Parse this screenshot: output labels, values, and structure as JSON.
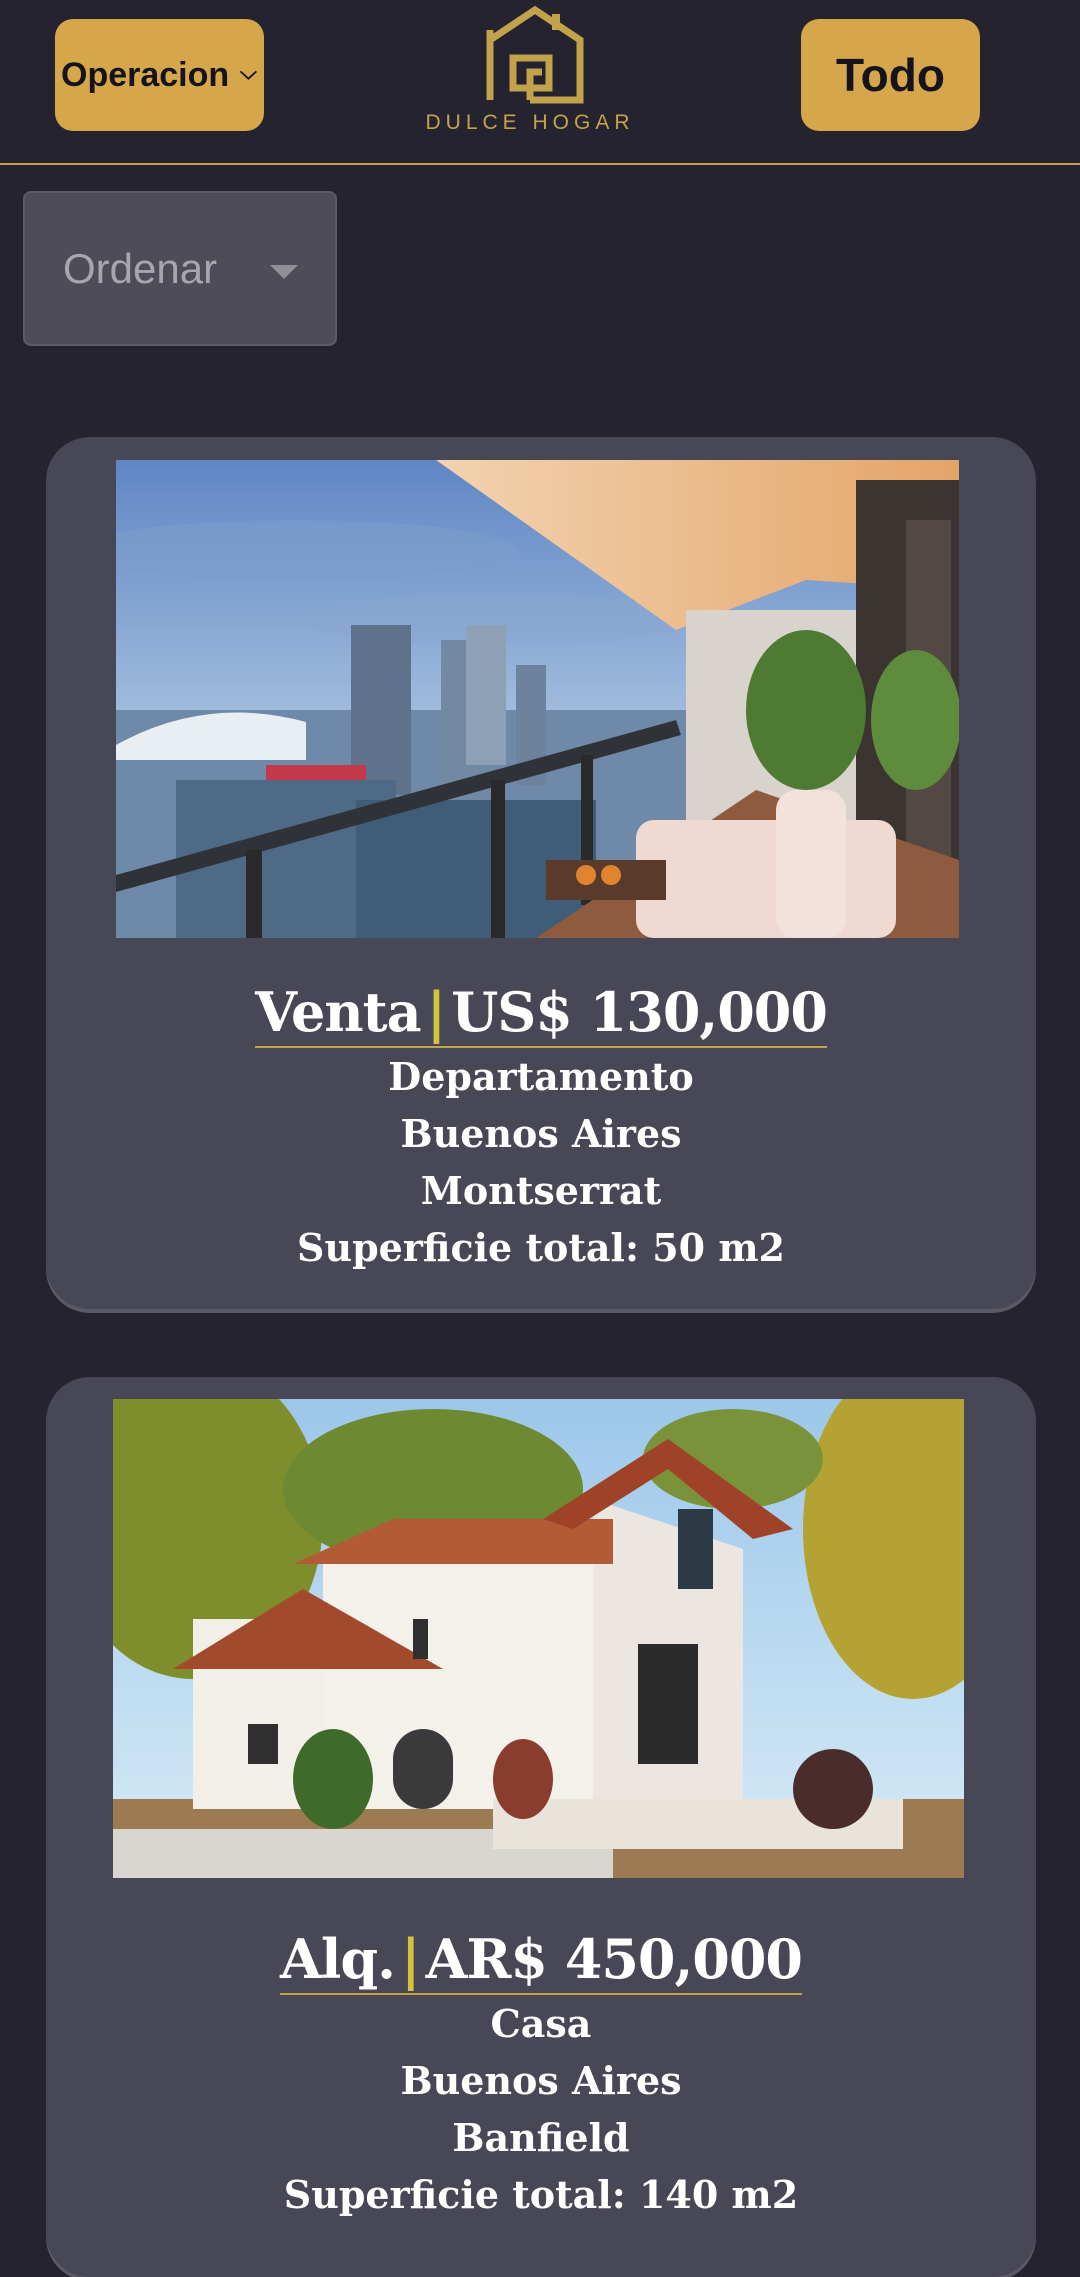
{
  "header": {
    "operation_label": "Operacion",
    "brand": "DULCE HOGAR",
    "all_label": "Todo"
  },
  "sort": {
    "placeholder": "Ordenar"
  },
  "colors": {
    "background": "#24232f",
    "card": "#484755",
    "accent": "#d5a64a",
    "gold_line": "#c2a24b"
  },
  "listings": [
    {
      "operation": "Venta",
      "price": "US$ 130,000",
      "type": "Departamento",
      "province": "Buenos Aires",
      "locality": "Montserrat",
      "area": "Superficie total: 50 m2"
    },
    {
      "operation": "Alq.",
      "price": "AR$ 450,000",
      "type": "Casa",
      "province": "Buenos Aires",
      "locality": "Banfield",
      "area": "Superficie total: 140 m2"
    }
  ]
}
